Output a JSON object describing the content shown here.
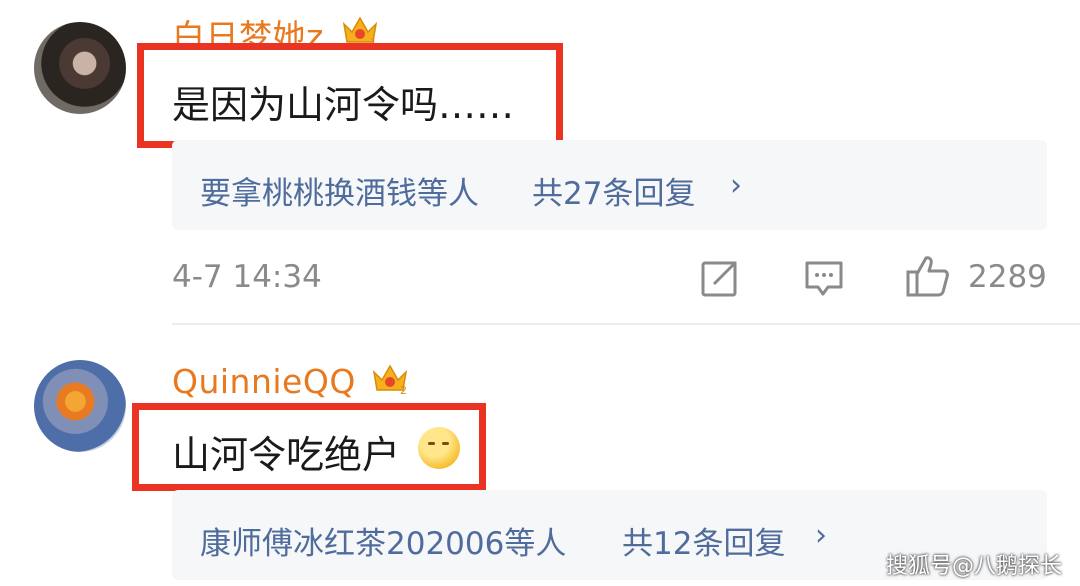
{
  "comments": [
    {
      "username": "白日梦她z",
      "text": "是因为山河令吗……",
      "reply_users": "要拿桃桃换酒钱等人",
      "reply_count": "共27条回复",
      "timestamp": "4-7 14:34",
      "likes": "2289",
      "badge_level": "1"
    },
    {
      "username": "QuinnieQQ",
      "text": "山河令吃绝户",
      "reply_users": "康师傅冰红茶202006等人",
      "reply_count": "共12条回复",
      "badge_level": "2"
    }
  ],
  "icons": {
    "chevron": "›",
    "share": "share-icon",
    "comment": "comment-icon",
    "like": "like-icon",
    "emoji": "shushing-face-emoji"
  },
  "watermark": "搜狐号@八鹅探长",
  "colors": {
    "username": "#e8791e",
    "highlight_border": "#ea3323",
    "reply_link": "#4f6c9c",
    "meta_text": "#8a8a8a",
    "reply_bg": "#f6f7f9"
  }
}
